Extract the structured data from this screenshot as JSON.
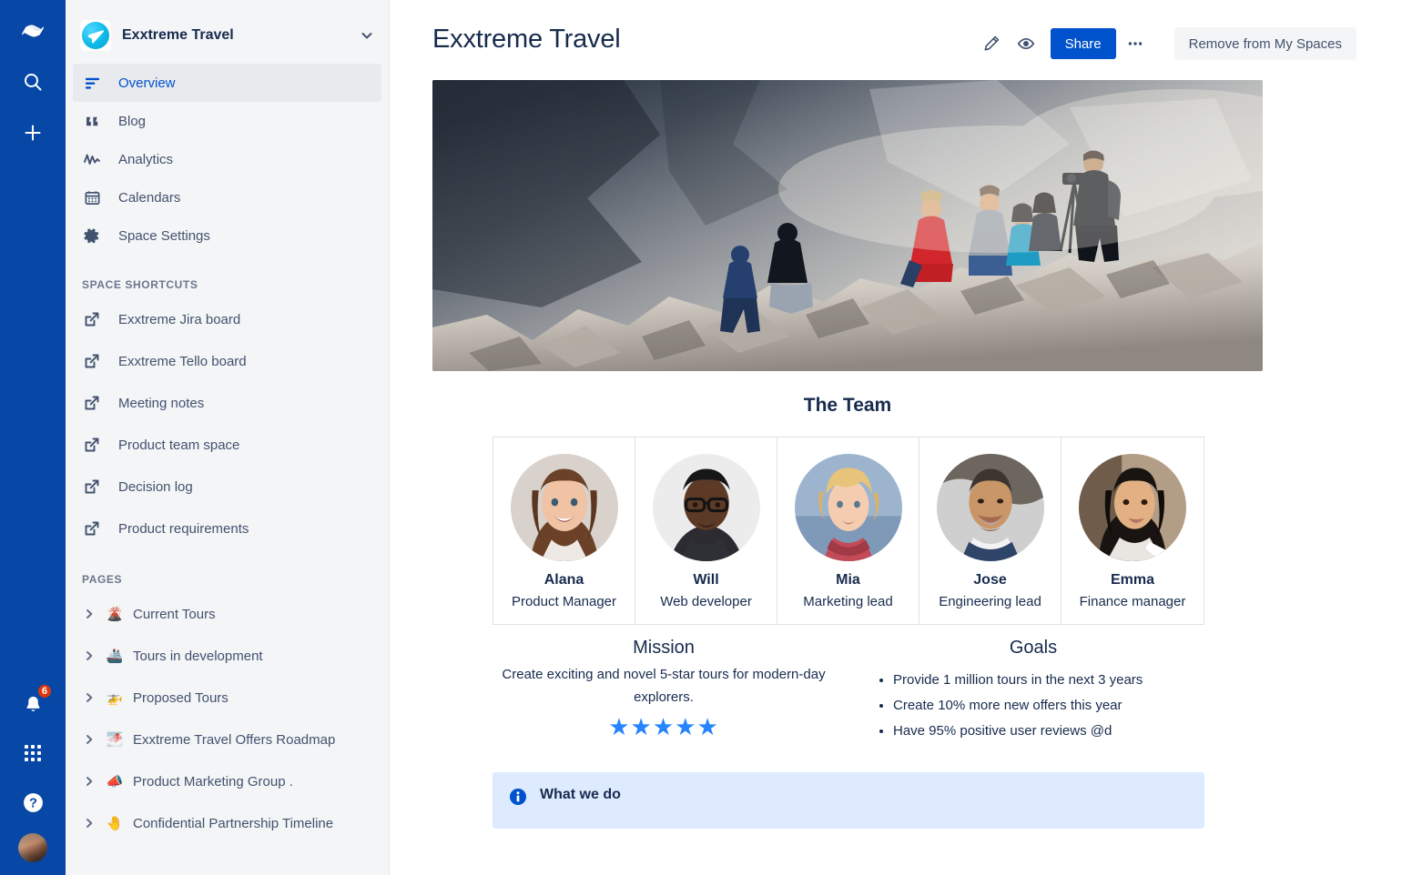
{
  "rail": {
    "logo_icon": "confluence-logo-icon",
    "buttons": [
      {
        "name": "search-icon",
        "label": "Search"
      },
      {
        "name": "create-icon",
        "label": "Create"
      }
    ],
    "notifications": {
      "icon": "bell-icon",
      "count": "6"
    },
    "apps_icon": "app-switcher-icon",
    "help_icon": "help-icon",
    "profile_icon": "user-avatar"
  },
  "sidebar": {
    "space": {
      "name": "Exxtreme Travel",
      "logo_icon": "rocket-plane-icon",
      "chevron_icon": "chevron-down-icon"
    },
    "nav": [
      {
        "label": "Overview",
        "icon": "overview-lines-icon",
        "selected": true
      },
      {
        "label": "Blog",
        "icon": "quote-icon",
        "selected": false
      },
      {
        "label": "Analytics",
        "icon": "analytics-wave-icon",
        "selected": false
      },
      {
        "label": "Calendars",
        "icon": "calendar-icon",
        "selected": false
      },
      {
        "label": "Space Settings",
        "icon": "gear-icon",
        "selected": false
      }
    ],
    "shortcuts_title": "SPACE SHORTCUTS",
    "shortcuts": [
      {
        "label": "Exxtreme Jira board",
        "icon": "external-link-icon"
      },
      {
        "label": "Exxtreme Tello board",
        "icon": "external-link-icon"
      },
      {
        "label": "Meeting notes",
        "icon": "external-link-icon"
      },
      {
        "label": "Product team space",
        "icon": "external-link-icon"
      },
      {
        "label": "Decision log",
        "icon": "external-link-icon"
      },
      {
        "label": "Product requirements",
        "icon": "external-link-icon"
      }
    ],
    "pages_title": "PAGES",
    "pages": [
      {
        "label": "Current Tours",
        "emoji": "🌋",
        "caret": "chevron-right-icon"
      },
      {
        "label": "Tours in development",
        "emoji": "🚢",
        "caret": "chevron-right-icon"
      },
      {
        "label": "Proposed Tours",
        "emoji": "🚁",
        "caret": "chevron-right-icon"
      },
      {
        "label": "Exxtreme Travel Offers Roadmap",
        "emoji": "🌁",
        "caret": "chevron-right-icon"
      },
      {
        "label": "Product Marketing Group .",
        "emoji": "📣",
        "caret": "chevron-right-icon"
      },
      {
        "label": "Confidential Partnership Timeline",
        "emoji": "🤚",
        "caret": "chevron-right-icon"
      }
    ]
  },
  "header": {
    "title": "Exxtreme Travel",
    "edit_icon": "pencil-icon",
    "watch_icon": "eye-icon",
    "share_label": "Share",
    "more_icon": "more-horizontal-icon",
    "remove_label": "Remove from My Spaces"
  },
  "content": {
    "hero_alt": "hikers-on-rocky-cliff-photo",
    "team_title": "The Team",
    "team": [
      {
        "name": "Alana",
        "role": "Product Manager"
      },
      {
        "name": "Will",
        "role": "Web developer"
      },
      {
        "name": "Mia",
        "role": "Marketing lead"
      },
      {
        "name": "Jose",
        "role": "Engineering lead"
      },
      {
        "name": "Emma",
        "role": "Finance manager"
      }
    ],
    "mission": {
      "title": "Mission",
      "text": "Create exciting and novel 5-star tours for modern-day explorers.",
      "stars": "★★★★★"
    },
    "goals": {
      "title": "Goals",
      "items": [
        "Provide 1 million tours in the next 3 years",
        "Create 10% more new offers this year",
        "Have 95% positive user reviews @d"
      ]
    },
    "panel": {
      "icon": "info-icon",
      "title": "What we do",
      "body": ""
    }
  },
  "colors": {
    "rail_blue": "#0747A6",
    "brand_blue": "#0052CC",
    "accent_blue": "#2684FF",
    "sidebar_bg": "#F4F5F7",
    "text_dark": "#172b4d",
    "badge_red": "#DE350B",
    "panel_bg": "#DEEBFF"
  }
}
